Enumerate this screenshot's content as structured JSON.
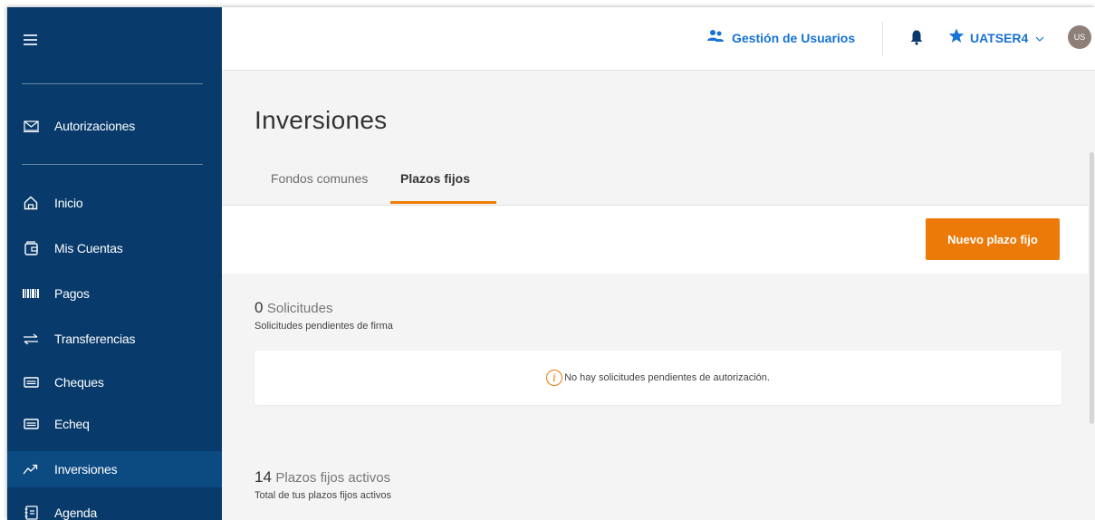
{
  "sidebar": {
    "items": [
      {
        "label": "Autorizaciones",
        "icon": "envelope-icon"
      },
      {
        "label": "Inicio",
        "icon": "home-icon"
      },
      {
        "label": "Mis Cuentas",
        "icon": "wallet-icon"
      },
      {
        "label": "Pagos",
        "icon": "barcode-icon"
      },
      {
        "label": "Transferencias",
        "icon": "transfer-arrows-icon"
      },
      {
        "label": "Cheques",
        "icon": "check-card-icon"
      },
      {
        "label": "Echeq",
        "icon": "echeq-card-icon"
      },
      {
        "label": "Inversiones",
        "icon": "trend-up-icon",
        "active": true
      },
      {
        "label": "Agenda",
        "icon": "contacts-icon"
      }
    ]
  },
  "header": {
    "gestion_label": "Gestión de Usuarios",
    "user_label": "UATSER4",
    "avatar_initials": "US"
  },
  "main": {
    "title": "Inversiones",
    "tabs": [
      {
        "label": "Fondos comunes"
      },
      {
        "label": "Plazos fijos",
        "active": true
      }
    ],
    "new_button": "Nuevo plazo fijo",
    "requests": {
      "count": "0",
      "label": "Solicitudes",
      "subtitle": "Solicitudes pendientes de firma",
      "empty_message": "No hay solicitudes pendientes de autorización."
    },
    "active": {
      "count": "14",
      "label": "Plazos fijos activos",
      "subtitle": "Total de tus plazos fijos activos"
    }
  },
  "colors": {
    "sidebar_bg": "#083a6b",
    "sidebar_active": "#0c4a82",
    "accent": "#ec7a08",
    "link_blue": "#1672d4"
  }
}
